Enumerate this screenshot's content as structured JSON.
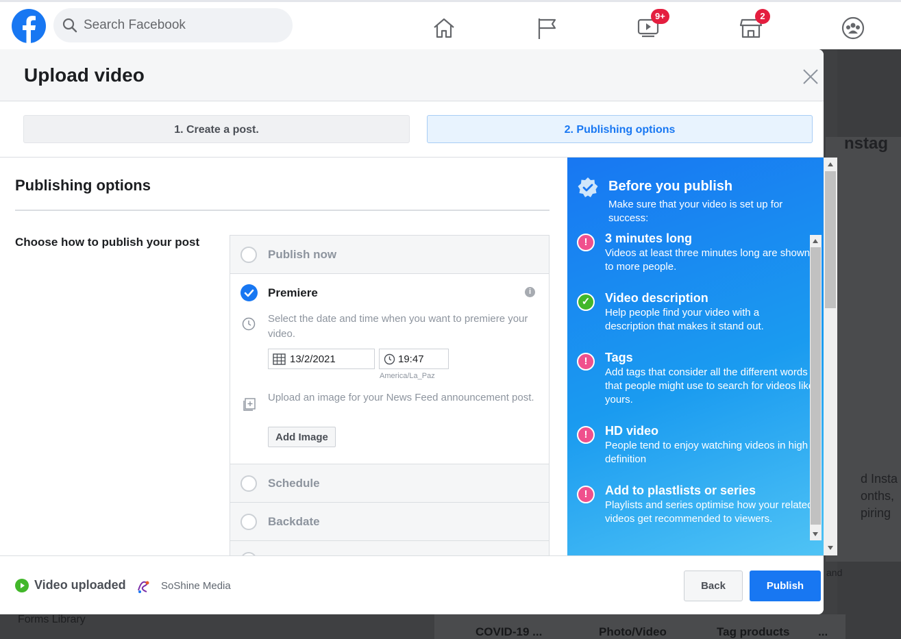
{
  "topbar": {
    "search_placeholder": "Search Facebook",
    "nav": [
      {
        "name": "home-icon"
      },
      {
        "name": "pages-flag-icon"
      },
      {
        "name": "watch-icon",
        "badge": "9+"
      },
      {
        "name": "marketplace-icon",
        "badge": "2"
      },
      {
        "name": "groups-icon"
      }
    ]
  },
  "modal": {
    "title": "Upload video",
    "steps": [
      "1. Create a post.",
      "2. Publishing options"
    ],
    "section_title": "Publishing options",
    "choose_label": "Choose how to publish your post",
    "options": {
      "publish_now": "Publish now",
      "premiere": "Premiere",
      "premiere_desc": "Select the date and time when you want to premiere your video.",
      "date": "13/2/2021",
      "time": "19:47",
      "timezone": "America/La_Paz",
      "image_desc": "Upload an image for your News Feed announcement post.",
      "add_image": "Add Image",
      "schedule": "Schedule",
      "backdate": "Backdate"
    },
    "panel": {
      "title": "Before you publish",
      "subtitle": "Make sure that your video is set up for success:",
      "tips": [
        {
          "title": "3 minutes long",
          "desc": "Videos at least three minutes long are shown to more people.",
          "status": "warn"
        },
        {
          "title": "Video description",
          "desc": "Help people find your video with a description that makes it stand out.",
          "status": "ok"
        },
        {
          "title": "Tags",
          "desc": "Add tags that consider all the different words that people might use to search for videos like yours.",
          "status": "warn"
        },
        {
          "title": "HD video",
          "desc": "People tend to enjoy watching videos in high definition",
          "status": "warn"
        },
        {
          "title": "Add to plastlists or series",
          "desc": "Playlists and series optimise how your related videos get recommended to viewers.",
          "status": "warn"
        }
      ]
    },
    "footer": {
      "status": "Video uploaded",
      "page_name": "SoShine Media",
      "back": "Back",
      "publish": "Publish"
    }
  },
  "background": {
    "partial_texts": [
      "nstag",
      "d Insta",
      "onths,",
      "piring",
      "and",
      "Forms Library"
    ],
    "bottom_actions": [
      "COVID-19 ...",
      "Photo/Video",
      "Tag products",
      "..."
    ]
  },
  "colors": {
    "brand": "#1877f2",
    "warn": "#f0508d",
    "ok": "#42b72a",
    "badge": "#e41e3f"
  }
}
